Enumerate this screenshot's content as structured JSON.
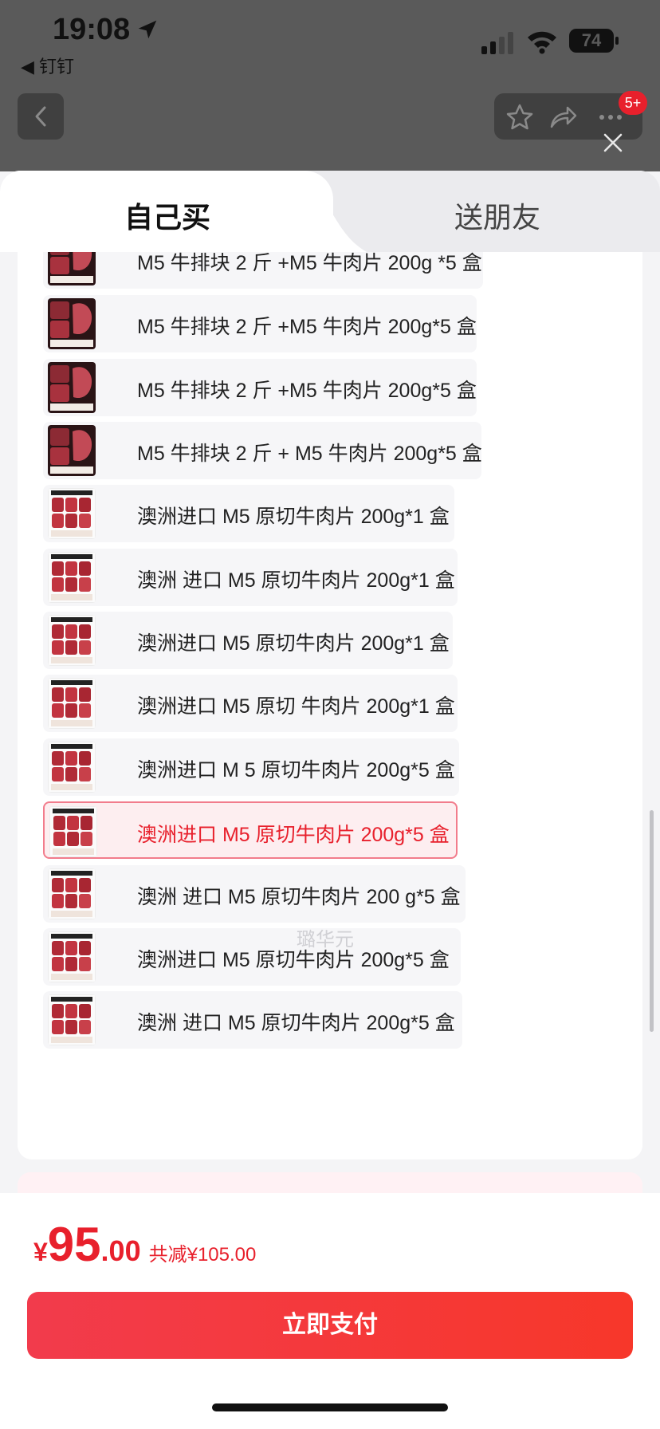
{
  "status_bar": {
    "time": "19:08",
    "back_app": "◀ 钉钉",
    "battery": "74"
  },
  "nav": {
    "badge": "5+"
  },
  "tabs": [
    {
      "label": "自己买",
      "active": true
    },
    {
      "label": "送朋友",
      "active": false
    }
  ],
  "watermark": "璐华元",
  "options": [
    {
      "label": "M5 牛排块 2 斤 +M5 牛肉片 200g *5 盒",
      "type": "steak",
      "selected": false
    },
    {
      "label": "M5 牛排块 2 斤 +M5 牛肉片 200g*5 盒",
      "type": "steak",
      "selected": false
    },
    {
      "label": "M5 牛排块 2 斤 +M5 牛肉片 200g*5 盒",
      "type": "steak",
      "selected": false
    },
    {
      "label": "M5 牛排块 2 斤 + M5 牛肉片 200g*5 盒",
      "type": "steak",
      "selected": false
    },
    {
      "label": "澳洲进口 M5 原切牛肉片 200g*1 盒",
      "type": "slice",
      "selected": false
    },
    {
      "label": "澳洲 进口 M5 原切牛肉片 200g*1 盒",
      "type": "slice",
      "selected": false
    },
    {
      "label": "澳洲进口 M5 原切牛肉片 200g*1 盒",
      "type": "slice",
      "selected": false
    },
    {
      "label": "澳洲进口 M5 原切 牛肉片 200g*1 盒",
      "type": "slice",
      "selected": false
    },
    {
      "label": "澳洲进口 M 5 原切牛肉片 200g*5 盒",
      "type": "slice",
      "selected": false
    },
    {
      "label": "澳洲进口 M5 原切牛肉片 200g*5 盒",
      "type": "slice",
      "selected": true
    },
    {
      "label": "澳洲 进口 M5 原切牛肉片 200 g*5 盒",
      "type": "slice",
      "selected": false
    },
    {
      "label": "澳洲进口 M5 原切牛肉片 200g*5 盒",
      "type": "slice",
      "selected": false
    },
    {
      "label": "澳洲 进口 M5 原切牛肉片 200g*5 盒",
      "type": "slice",
      "selected": false
    }
  ],
  "price": {
    "currency": "¥",
    "integer": "95",
    "decimal": ".00",
    "discount": "共减¥105.00"
  },
  "pay_button": "立即支付",
  "colors": {
    "accent": "#e8202c",
    "selected_bg": "#fdeef0",
    "selected_border": "#f27c8c"
  }
}
